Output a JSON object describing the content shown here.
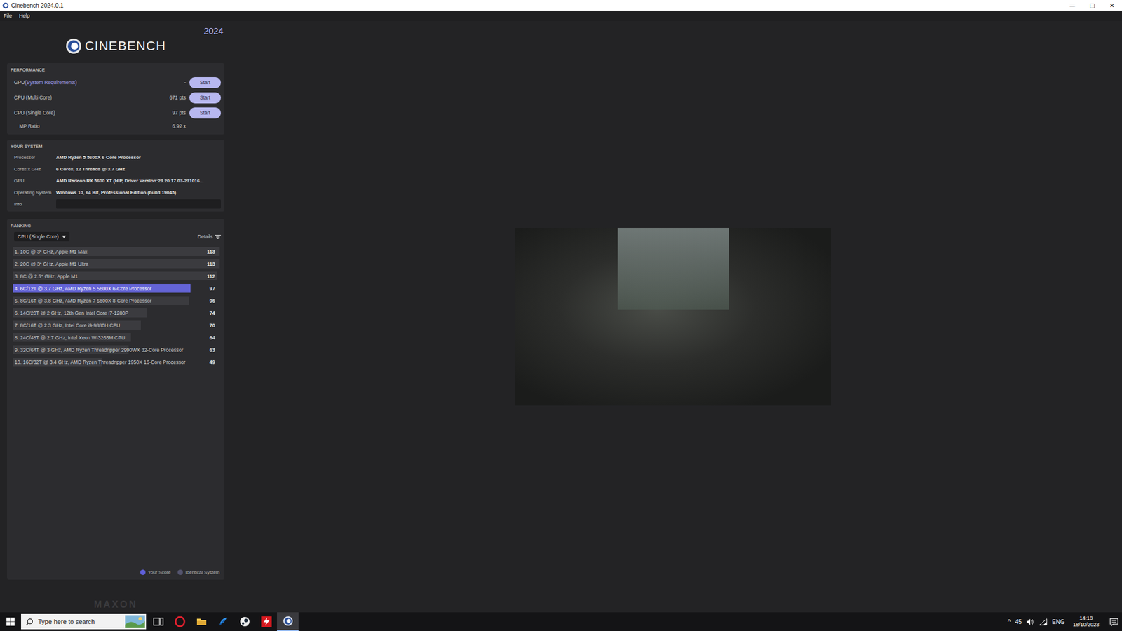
{
  "window": {
    "title": "Cinebench 2024.0.1",
    "controls": [
      "—",
      "□",
      "✕"
    ]
  },
  "menu": [
    "File",
    "Help"
  ],
  "logo": {
    "name": "CINEBENCH",
    "year": "2024"
  },
  "performance": {
    "title": "PERFORMANCE",
    "rows": [
      {
        "label": "GPU",
        "link": "(System Requirements)",
        "value": "-",
        "button": "Start"
      },
      {
        "label": "CPU (Multi Core)",
        "value": "671 pts",
        "button": "Start"
      },
      {
        "label": "CPU (Single Core)",
        "value": "97 pts",
        "button": "Start"
      }
    ],
    "ratio": {
      "label": "MP Ratio",
      "value": "6.92 x"
    }
  },
  "system": {
    "title": "YOUR SYSTEM",
    "rows": [
      {
        "label": "Processor",
        "value": "AMD Ryzen 5 5600X 6-Core Processor"
      },
      {
        "label": "Cores x GHz",
        "value": "6 Cores, 12 Threads @ 3.7 GHz"
      },
      {
        "label": "GPU",
        "value": "AMD Radeon RX 5600 XT (HIP, Driver Version:23.20.17.03-231016..."
      },
      {
        "label": "Operating System",
        "value": "Windows 10, 64 Bit, Professional Edition (build 19045)"
      }
    ],
    "info": {
      "label": "Info",
      "value": ""
    }
  },
  "ranking": {
    "title": "RANKING",
    "dropdown": "CPU (Single Core)",
    "details": "Details",
    "rows": [
      {
        "label": "1. 10C @ 3* GHz, Apple M1 Max",
        "score": "113",
        "level": 1.0,
        "selected": false
      },
      {
        "label": "2. 20C @ 3* GHz, Apple M1 Ultra",
        "score": "113",
        "level": 1.0,
        "selected": false
      },
      {
        "label": "3. 8C @ 2.5* GHz, Apple M1",
        "score": "112",
        "level": 0.99,
        "selected": false
      },
      {
        "label": "4. 6C/12T @ 3.7 GHz, AMD Ryzen 5 5600X 6-Core Processor",
        "score": "97",
        "level": 0.86,
        "selected": true
      },
      {
        "label": "5. 8C/16T @ 3.8 GHz, AMD Ryzen 7 5800X 8-Core Processor",
        "score": "96",
        "level": 0.85,
        "selected": false
      },
      {
        "label": "6. 14C/20T @ 2 GHz, 12th Gen Intel Core i7-1280P",
        "score": "74",
        "level": 0.65,
        "selected": false
      },
      {
        "label": "7. 8C/16T @ 2.3 GHz, Intel Core i9-9880H CPU",
        "score": "70",
        "level": 0.62,
        "selected": false
      },
      {
        "label": "8. 24C/48T @ 2.7 GHz, Intel Xeon W-3265M CPU",
        "score": "64",
        "level": 0.57,
        "selected": false
      },
      {
        "label": "9. 32C/64T @ 3 GHz, AMD Ryzen Threadripper 2990WX 32-Core Processor",
        "score": "63",
        "level": 0.56,
        "selected": false
      },
      {
        "label": "10. 16C/32T @ 3.4 GHz, AMD Ryzen Threadripper 1950X 16-Core Processor",
        "score": "49",
        "level": 0.43,
        "selected": false
      }
    ],
    "legend": [
      {
        "label": "Your Score",
        "color": "#5f5fd8"
      },
      {
        "label": "Identical System",
        "color": "#54546e"
      }
    ]
  },
  "footer": {
    "brand": "MAXON"
  },
  "taskbar": {
    "search": {
      "placeholder": "Type here to search"
    },
    "apps": [
      {
        "kind": "task-view",
        "active": false
      },
      {
        "kind": "opera",
        "active": false
      },
      {
        "kind": "explorer",
        "active": false
      },
      {
        "kind": "blue-app",
        "active": false
      },
      {
        "kind": "steam",
        "active": false
      },
      {
        "kind": "red-app",
        "active": false
      },
      {
        "kind": "cinebench",
        "active": true
      }
    ],
    "tray": {
      "chevron": "^",
      "temperature": "45",
      "language": "ENG",
      "time": "14:18",
      "date": "18/10/2023"
    }
  }
}
